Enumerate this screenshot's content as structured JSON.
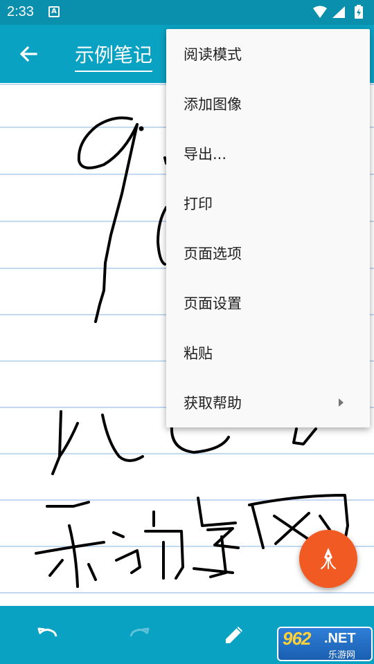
{
  "status_bar": {
    "time": "2:33",
    "notification_glyph": "A"
  },
  "toolbar": {
    "title": "示例笔记",
    "back_icon": "arrow-left-icon"
  },
  "menu": {
    "items": [
      {
        "label": "阅读模式"
      },
      {
        "label": "添加图像"
      },
      {
        "label": "导出..."
      },
      {
        "label": "打印"
      },
      {
        "label": "页面选项"
      },
      {
        "label": "页面设置"
      },
      {
        "label": "粘贴"
      },
      {
        "label": "获取帮助",
        "submenu": true
      }
    ]
  },
  "bottom_bar": {
    "icons": [
      "undo-icon",
      "redo-icon",
      "pen-icon"
    ]
  },
  "fab": {
    "icon": "fountain-pen-icon",
    "color": "#f15a22"
  },
  "watermark": {
    "big": "962",
    "net": ".NET",
    "cn": "乐游网"
  },
  "colors": {
    "app_bar": "#0aa2c3",
    "status_bar": "#0a8fad",
    "ruled_line": "#c3d9f2",
    "accent": "#f15a22"
  }
}
